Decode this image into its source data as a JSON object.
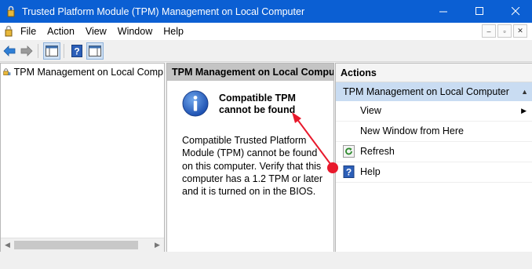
{
  "window": {
    "title": "Trusted Platform Module (TPM) Management on Local Computer",
    "minimize_glyph": "—",
    "maximize_glyph": "☐",
    "close_glyph": "✕",
    "title_bar_color": "#0b5fd3"
  },
  "menubar": {
    "items": [
      {
        "label": "File"
      },
      {
        "label": "Action"
      },
      {
        "label": "View"
      },
      {
        "label": "Window"
      },
      {
        "label": "Help"
      }
    ],
    "mdi_buttons": [
      "–",
      "▫",
      "✕"
    ]
  },
  "toolbar": {
    "icons": [
      "back-arrow-icon",
      "forward-arrow-icon",
      "show-hide-console-tree-icon",
      "help-icon",
      "show-hide-action-pane-icon"
    ]
  },
  "tree": {
    "root_label": "TPM Management on Local Comp"
  },
  "center": {
    "header": "TPM Management on Local Compu...",
    "message_title": "Compatible TPM cannot be found",
    "message_body": "Compatible Trusted Platform Module (TPM) cannot be found on this computer. Verify that this computer has a 1.2 TPM or later and it is turned on in the BIOS."
  },
  "actions": {
    "header": "Actions",
    "group_label": "TPM Management on Local Computer",
    "items": [
      {
        "label": "View",
        "icon": "",
        "has_submenu": true
      },
      {
        "label": "New Window from Here",
        "icon": ""
      },
      {
        "label": "Refresh",
        "icon": "refresh-icon"
      },
      {
        "label": "Help",
        "icon": "help-icon"
      }
    ],
    "group_color": "#c9dcf2"
  },
  "annotation": {
    "color": "#e8192c"
  }
}
